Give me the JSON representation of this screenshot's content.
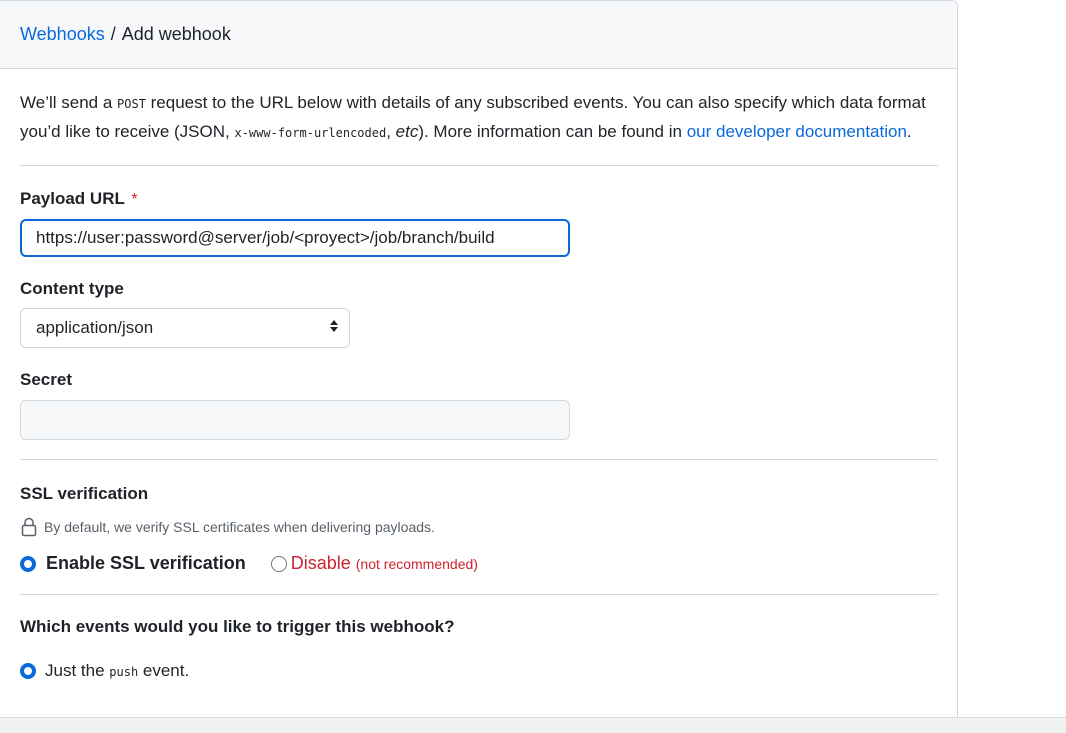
{
  "breadcrumb": {
    "link": "Webhooks",
    "separator": "/",
    "current": "Add webhook"
  },
  "intro": {
    "part1": "We’ll send a ",
    "post_code": "POST",
    "part2": " request to the URL below with details of any subscribed events. You can also specify which data format you’d like to receive (JSON, ",
    "form_code": "x-www-form-urlencoded",
    "part3": ", ",
    "etc": "etc",
    "part4": "). More information can be found in ",
    "link": "our developer documentation",
    "part5": "."
  },
  "payload": {
    "label": "Payload URL",
    "required_mark": "*",
    "value": "https://user:password@server/job/<proyect>/job/branch/build"
  },
  "content_type": {
    "label": "Content type",
    "selected": "application/json"
  },
  "secret": {
    "label": "Secret",
    "value": ""
  },
  "ssl": {
    "label": "SSL verification",
    "note": "By default, we verify SSL certificates when delivering payloads.",
    "enable_label": "Enable SSL verification",
    "disable_label": "Disable",
    "disable_hint": "(not recommended)",
    "selected": "enable"
  },
  "events": {
    "question": "Which events would you like to trigger this webhook?",
    "option1_pre": "Just the ",
    "option1_code": "push",
    "option1_post": " event.",
    "selected": "push"
  },
  "colors": {
    "link": "#0969da",
    "danger": "#cf222e",
    "border": "#d0d7de",
    "header_bg": "#f6f8fa"
  },
  "icons": {
    "lock": "lock-icon",
    "select": "select-arrows-icon"
  }
}
